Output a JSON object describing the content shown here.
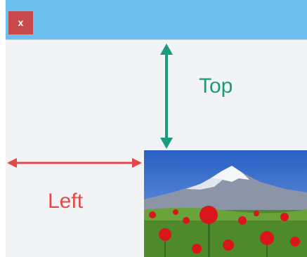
{
  "window": {
    "close_label": "x"
  },
  "labels": {
    "top": "Top",
    "left": "Left"
  },
  "colors": {
    "titlebar": "#6cc0ef",
    "close_button": "#c94a4a",
    "top_arrow": "#1a9b7e",
    "left_arrow": "#e24a4a",
    "client_bg": "#f2f3f4"
  },
  "icons": {
    "close": "close-icon"
  }
}
